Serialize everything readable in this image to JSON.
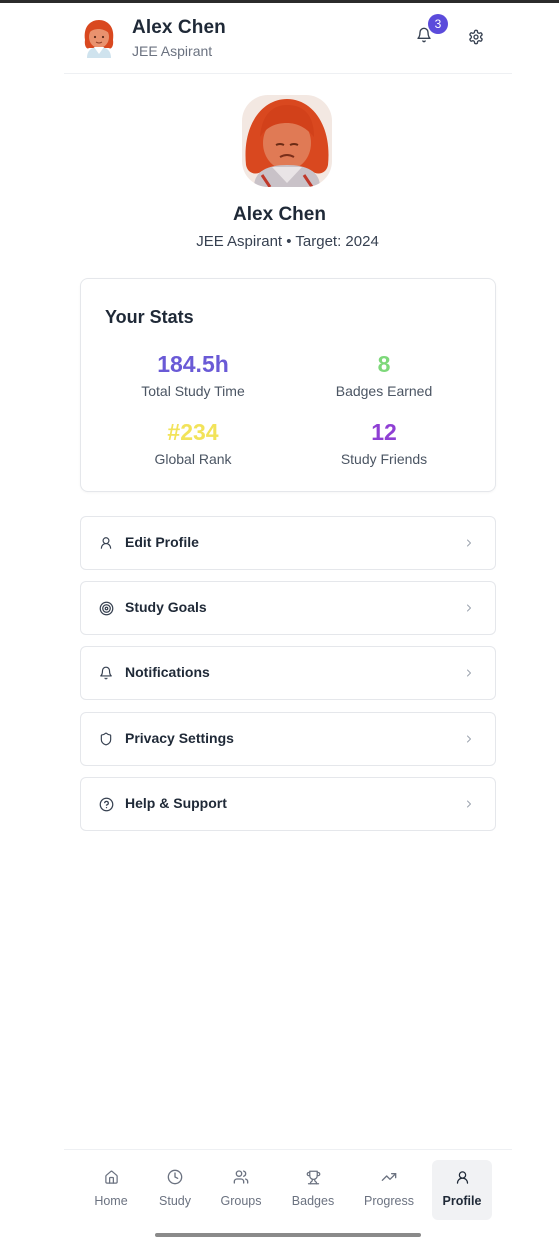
{
  "header": {
    "name": "Alex Chen",
    "subtitle": "JEE Aspirant",
    "notification_count": "3"
  },
  "profile": {
    "name": "Alex Chen",
    "subtitle": "JEE Aspirant • Target: 2024"
  },
  "stats": {
    "title": "Your Stats",
    "items": [
      {
        "value": "184.5h",
        "label": "Total Study Time",
        "color": "#6a5ad6"
      },
      {
        "value": "8",
        "label": "Badges Earned",
        "color": "#7dd87a"
      },
      {
        "value": "#234",
        "label": "Global Rank",
        "color": "#f2e35a"
      },
      {
        "value": "12",
        "label": "Study Friends",
        "color": "#8f3fd4"
      }
    ]
  },
  "menu": [
    {
      "label": "Edit Profile",
      "icon": "user-icon"
    },
    {
      "label": "Study Goals",
      "icon": "target-icon"
    },
    {
      "label": "Notifications",
      "icon": "bell-icon"
    },
    {
      "label": "Privacy Settings",
      "icon": "shield-icon"
    },
    {
      "label": "Help & Support",
      "icon": "help-circle-icon"
    }
  ],
  "nav": [
    {
      "label": "Home",
      "icon": "home-icon"
    },
    {
      "label": "Study",
      "icon": "clock-icon"
    },
    {
      "label": "Groups",
      "icon": "users-icon"
    },
    {
      "label": "Badges",
      "icon": "trophy-icon"
    },
    {
      "label": "Progress",
      "icon": "trending-up-icon"
    },
    {
      "label": "Profile",
      "icon": "user-icon",
      "active": true
    }
  ],
  "colors": {
    "accent": "#5b4bdb",
    "avatar_hair": "#d9481f",
    "avatar_skin": "#e07a55"
  }
}
